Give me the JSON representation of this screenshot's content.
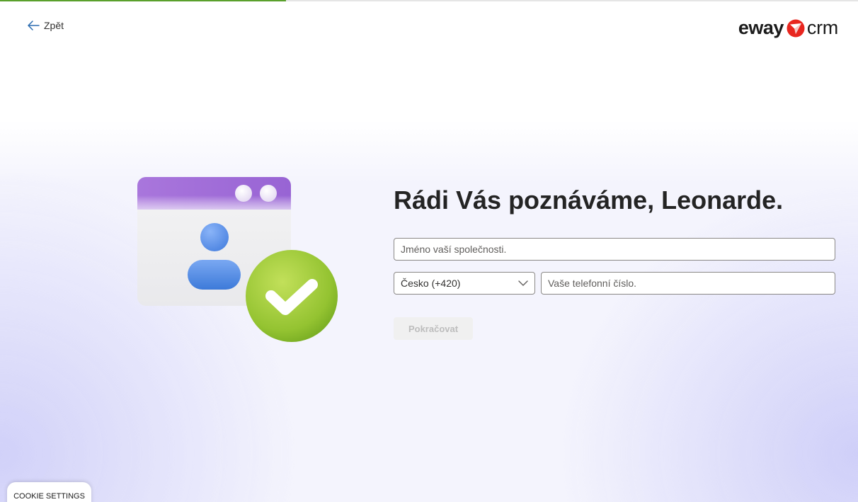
{
  "progress": {
    "fraction": 0.333,
    "color": "#5aa02c"
  },
  "nav": {
    "back_label": "Zpět"
  },
  "logo": {
    "word1": "eway",
    "word2": "crm",
    "mark_color": "#e8261f"
  },
  "main": {
    "title": "Rádi Vás poznáváme, Leonarde.",
    "company_placeholder": "Jméno vaší společnosti.",
    "country_value": "Česko (+420)",
    "phone_placeholder": "Vaše telefonní číslo.",
    "continue_label": "Pokračovat"
  },
  "cookie": {
    "label": "COOKIE SETTINGS"
  },
  "illustration": {
    "icons": [
      "browser-window-icon",
      "user-icon",
      "checkmark-icon"
    ]
  }
}
